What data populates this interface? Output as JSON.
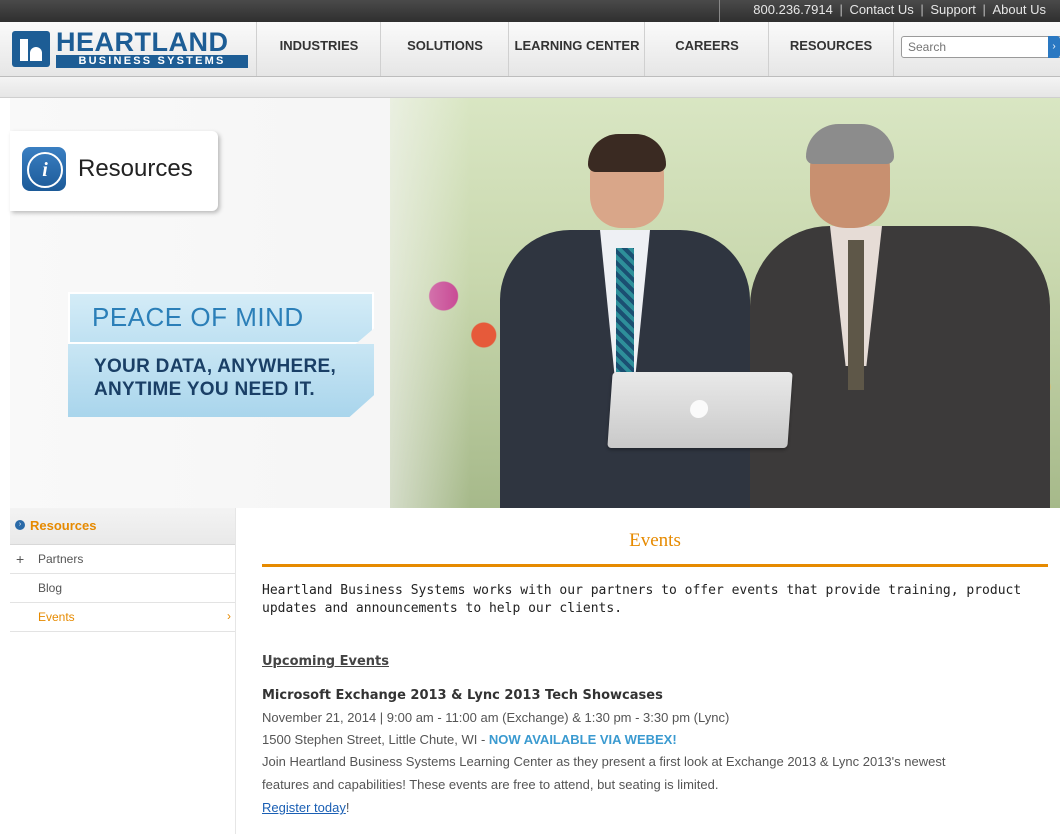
{
  "topbar": {
    "phone": "800.236.7914",
    "links": [
      "Contact Us",
      "Support",
      "About Us"
    ]
  },
  "logo": {
    "name": "HEARTLAND",
    "subtitle": "BUSINESS SYSTEMS"
  },
  "nav": {
    "items": [
      "INDUSTRIES",
      "SOLUTIONS",
      "LEARNING CENTER",
      "CAREERS",
      "RESOURCES"
    ],
    "search_placeholder": "Search"
  },
  "hero": {
    "section_label": "Resources",
    "banner_top": "PEACE OF MIND",
    "banner_line1": "YOUR DATA, ANYWHERE,",
    "banner_line2": "ANYTIME YOU NEED IT."
  },
  "sidebar": {
    "heading": "Resources",
    "items": [
      {
        "label": "Partners",
        "prefix": "+"
      },
      {
        "label": "Blog"
      },
      {
        "label": "Events",
        "suffix": "›"
      }
    ]
  },
  "main": {
    "title": "Events",
    "intro": "Heartland Business Systems works with our partners to offer events that provide training, product updates and announcements to help our clients.",
    "upcoming_heading": "Upcoming Events",
    "event": {
      "title": "Microsoft Exchange 2013 & Lync 2013 Tech Showcases",
      "datetime": "November 21, 2014 | 9:00 am - 11:00 am (Exchange) & 1:30 pm - 3:30 pm (Lync)",
      "location": "1500 Stephen Street, Little Chute, WI - ",
      "webex": "NOW AVAILABLE VIA WEBEX!",
      "description_1": "Join Heartland Business Systems Learning Center as they present a first look at Exchange 2013 & Lync 2013's newest",
      "description_2": "features and capabilities! These events are free to attend, but seating is limited.",
      "register_link": "Register today",
      "register_after": "!"
    }
  }
}
